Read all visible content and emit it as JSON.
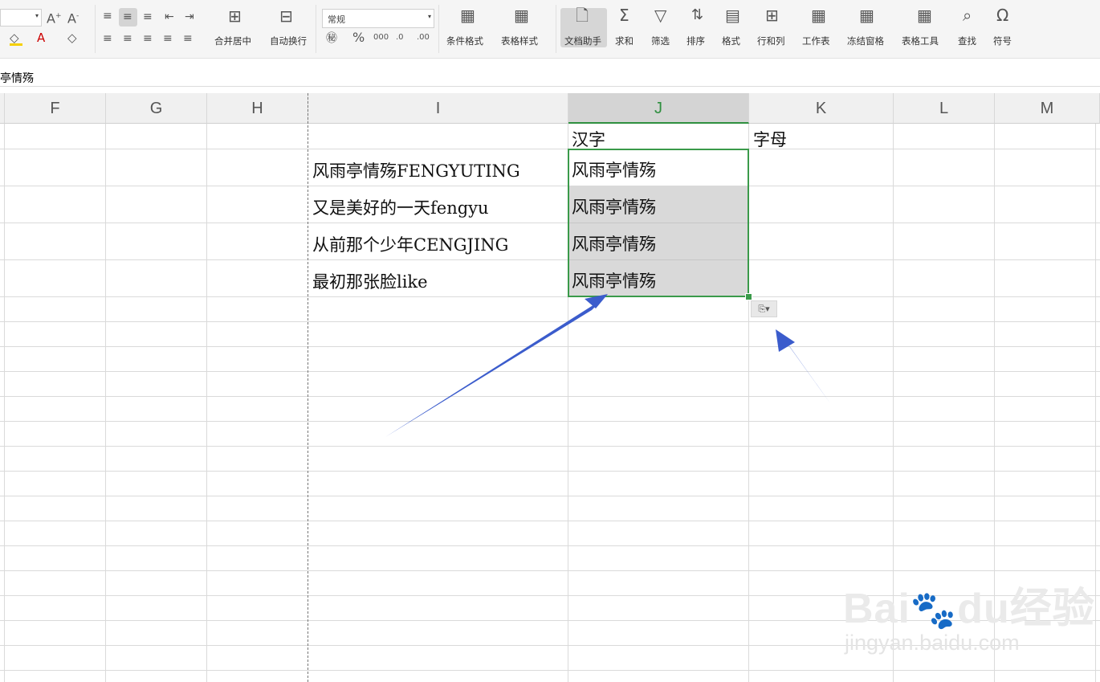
{
  "ribbon": {
    "number_format": "常规",
    "merge_center": "合并居中",
    "auto_wrap": "自动换行",
    "cond_format": "条件格式",
    "table_style": "表格样式",
    "doc_assistant": "文档助手",
    "sum": "求和",
    "filter": "筛选",
    "sort": "排序",
    "format": "格式",
    "row_col": "行和列",
    "worksheet": "工作表",
    "freeze": "冻结窗格",
    "table_tools": "表格工具",
    "find": "查找",
    "symbol": "符号"
  },
  "formula_bar": {
    "value": "亭情殇"
  },
  "columns": [
    "F",
    "G",
    "H",
    "I",
    "J",
    "K",
    "L",
    "M"
  ],
  "selected_column": "J",
  "cells": {
    "J1": "汉字",
    "K1": "字母",
    "I2": "风雨亭情殇FENGYUTING",
    "I3": "又是美好的一天fengyu",
    "I4": "从前那个少年CENGJING",
    "I5": "最初那张脸like",
    "J2": "风雨亭情殇",
    "J3": "风雨亭情殇",
    "J4": "风雨亭情殇",
    "J5": "风雨亭情殇"
  },
  "watermark": {
    "brand": "Bai",
    "brand_suffix": "du",
    "brand_cn": "经验",
    "url": "jingyan.baidu.com"
  },
  "colors": {
    "accent": "#3a9a4a",
    "arrow": "#3b5ccc",
    "selection_fill": "#d9d9d9"
  }
}
